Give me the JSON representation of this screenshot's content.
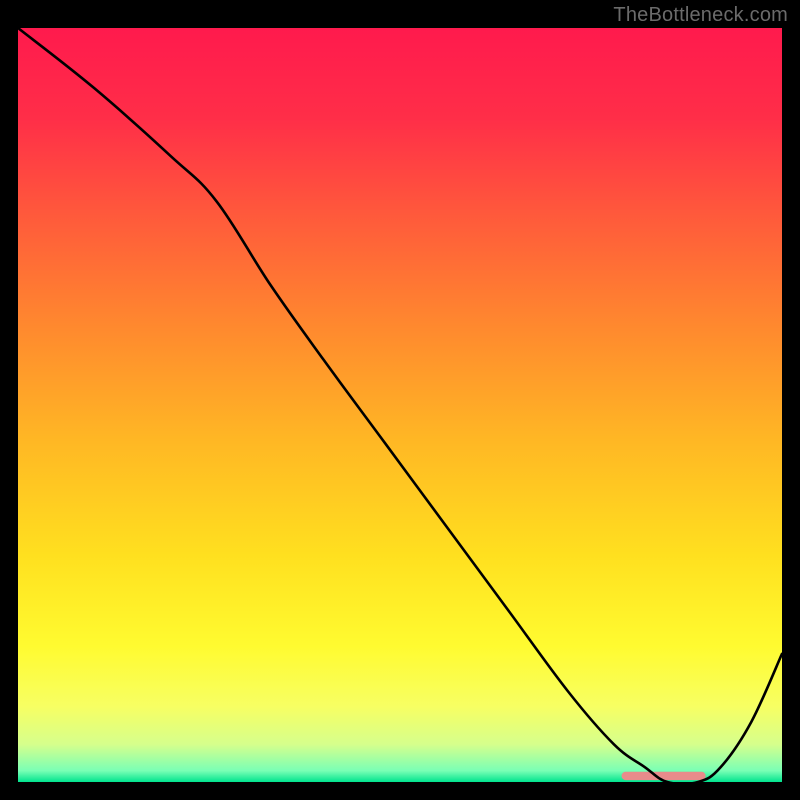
{
  "watermark": "TheBottleneck.com",
  "chart_data": {
    "type": "line",
    "title": "",
    "xlabel": "",
    "ylabel": "",
    "xlim": [
      0,
      100
    ],
    "ylim": [
      0,
      100
    ],
    "grid": false,
    "legend": false,
    "background_gradient": {
      "stops": [
        {
          "offset": 0.0,
          "color": "#ff1a4d"
        },
        {
          "offset": 0.12,
          "color": "#ff2e48"
        },
        {
          "offset": 0.25,
          "color": "#ff5a3b"
        },
        {
          "offset": 0.4,
          "color": "#ff8a2e"
        },
        {
          "offset": 0.55,
          "color": "#ffb824"
        },
        {
          "offset": 0.7,
          "color": "#ffe01f"
        },
        {
          "offset": 0.82,
          "color": "#fffb30"
        },
        {
          "offset": 0.9,
          "color": "#f7ff63"
        },
        {
          "offset": 0.95,
          "color": "#d6ff8c"
        },
        {
          "offset": 0.985,
          "color": "#7affb5"
        },
        {
          "offset": 1.0,
          "color": "#00e38e"
        }
      ]
    },
    "series": [
      {
        "name": "curve",
        "color": "#000000",
        "x": [
          0,
          10,
          20,
          26,
          33,
          40,
          48,
          56,
          64,
          72,
          78,
          82,
          85,
          89,
          92,
          96,
          100
        ],
        "y": [
          100,
          92,
          83,
          77,
          66,
          56,
          45,
          34,
          23,
          12,
          5,
          2,
          0,
          0,
          2,
          8,
          17
        ]
      }
    ],
    "highlight_segment": {
      "name": "pink-bar",
      "color": "#e88b8b",
      "x_start": 79,
      "x_end": 90,
      "y": 0.8,
      "thickness": 1.1
    }
  }
}
